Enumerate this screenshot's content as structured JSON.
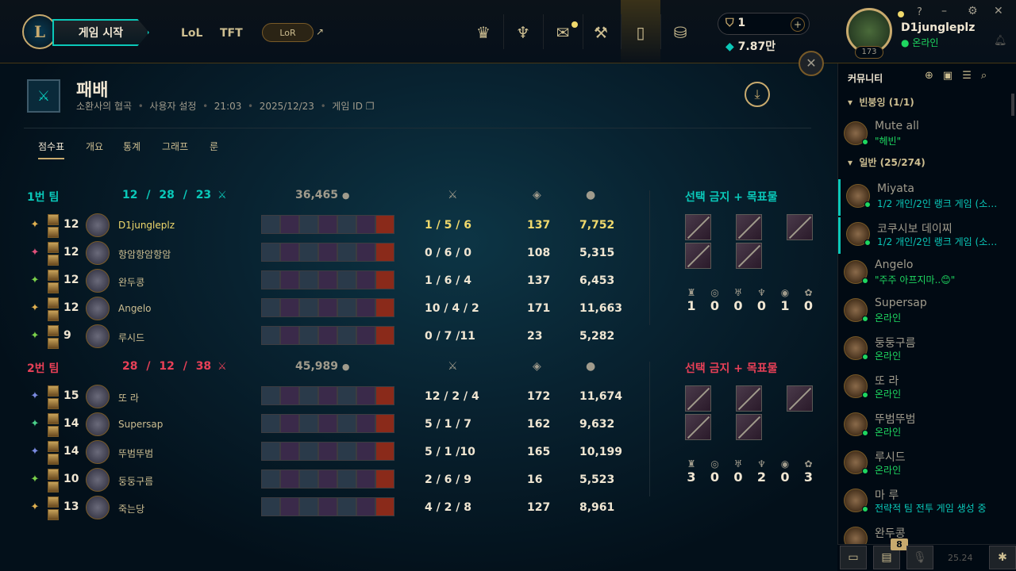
{
  "topbar": {
    "play_label": "게임 시작",
    "nav": [
      "LoL",
      "TFT"
    ],
    "lor_label": "LoR",
    "lor_ext": "↗",
    "rp": "1",
    "be": "7.87만",
    "plus": "+"
  },
  "profile": {
    "name": "D1jungleplz",
    "status": "온라인",
    "level": "173"
  },
  "match": {
    "result": "패배",
    "mode": "소환사의 협곡",
    "type": "사용자 설정",
    "duration": "21:03",
    "date": "2025/12/23",
    "game_id_label": "게임 ID",
    "sep": "•"
  },
  "tabs": [
    "점수표",
    "개요",
    "통계",
    "그래프",
    "룬"
  ],
  "team1": {
    "name": "1번 팀",
    "kda": "12 / 28 / 23",
    "gold": "36,465",
    "bans_label": "선택 금지 + 목표물",
    "objectives": [
      "1",
      "0",
      "0",
      "0",
      "1",
      "0"
    ],
    "players": [
      {
        "level": "12",
        "name": "D1jungleplz",
        "kda": "1 / 5 / 6",
        "cs": "137",
        "gold": "7,752"
      },
      {
        "level": "12",
        "name": "항암항암항암",
        "kda": "0 / 6 / 0",
        "cs": "108",
        "gold": "5,315"
      },
      {
        "level": "12",
        "name": "완두콩",
        "kda": "1 / 6 / 4",
        "cs": "137",
        "gold": "6,453"
      },
      {
        "level": "12",
        "name": "Angelo",
        "kda": "10 / 4 / 2",
        "cs": "171",
        "gold": "11,663"
      },
      {
        "level": "9",
        "name": "루시드",
        "kda": "0 / 7 /11",
        "cs": "23",
        "gold": "5,282"
      }
    ]
  },
  "team2": {
    "name": "2번 팀",
    "kda": "28 / 12 / 38",
    "gold": "45,989",
    "bans_label": "선택 금지 + 목표물",
    "objectives": [
      "3",
      "0",
      "0",
      "2",
      "0",
      "3"
    ],
    "players": [
      {
        "level": "15",
        "name": "또 라",
        "kda": "12 / 2 / 4",
        "cs": "172",
        "gold": "11,674"
      },
      {
        "level": "14",
        "name": "Supersap",
        "kda": "5 / 1 / 7",
        "cs": "162",
        "gold": "9,632"
      },
      {
        "level": "14",
        "name": "뚜범뚜범",
        "kda": "5 / 1 /10",
        "cs": "165",
        "gold": "10,199"
      },
      {
        "level": "10",
        "name": "둥둥구름",
        "kda": "2 / 6 / 9",
        "cs": "16",
        "gold": "5,523"
      },
      {
        "level": "13",
        "name": "죽는당",
        "kda": "4 / 2 / 8",
        "cs": "127",
        "gold": "8,961"
      }
    ]
  },
  "social": {
    "title": "커뮤니티",
    "group1": "빈붕잉 (1/1)",
    "group2": "일반 (25/274)",
    "friends": [
      {
        "name": "Mute all",
        "status": "\"헤빈\""
      },
      {
        "name": "Miyata",
        "status": "1/2 개인/2인 랭크 게임 (소…"
      },
      {
        "name": "코쿠시보 데이찌",
        "status": "1/2 개인/2인 랭크 게임 (소…"
      },
      {
        "name": "Angelo",
        "status": "\"주주 아프지마..😊\""
      },
      {
        "name": "Supersap",
        "status": "온라인"
      },
      {
        "name": "둥둥구름",
        "status": "온라인"
      },
      {
        "name": "또 라",
        "status": "온라인"
      },
      {
        "name": "뚜범뚜범",
        "status": "온라인"
      },
      {
        "name": "루시드",
        "status": "온라인"
      },
      {
        "name": "마 루",
        "status": "전략적 팀 전투 게임 생성 중"
      },
      {
        "name": "완두콩",
        "status": ""
      }
    ],
    "badge": "8",
    "version": "25.24"
  }
}
